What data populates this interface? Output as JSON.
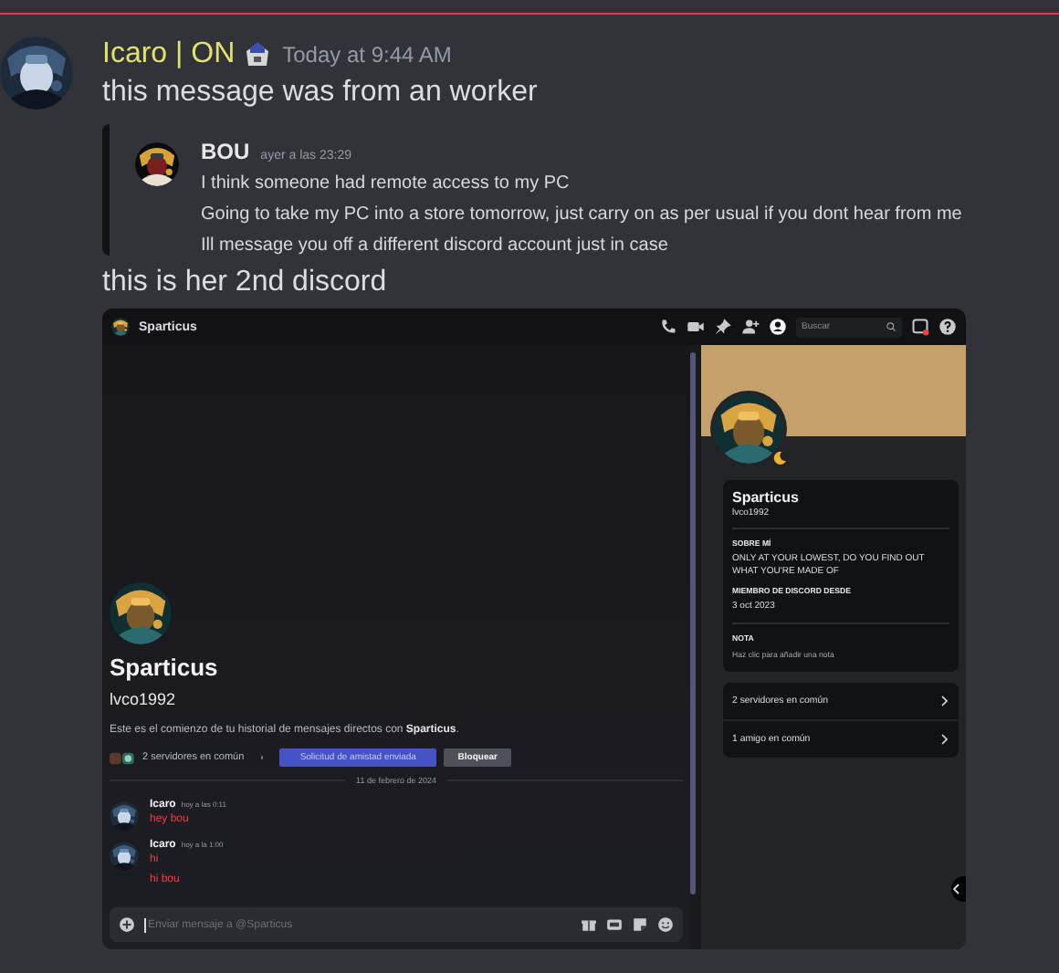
{
  "message": {
    "author": "Icaro | ON",
    "time": "Today at 9:44 AM",
    "text": "this message was from an worker"
  },
  "quote": {
    "author": "BOU",
    "time": "ayer a las 23:29",
    "lines": [
      "I think someone had remote access to my PC",
      "Going to take my PC into a store tomorrow, just carry on as per usual if you dont hear from me",
      "Ill message you off a different discord account just in case"
    ]
  },
  "message_2": {
    "text": "this is her 2nd discord"
  },
  "screenshot": {
    "header": {
      "title": "Sparticus"
    },
    "search": {
      "placeholder": "Buscar"
    },
    "intro": {
      "display_name": "Sparticus",
      "username": "lvco1992",
      "text": "Este es el comienzo de tu historial de mensajes directos con **Sparticus**.",
      "mutual_servers": "2 servidores en común",
      "friend_request": "Solicitud de amistad enviada",
      "block": "Bloquear"
    },
    "date_divider": "11 de febrero de 2024",
    "messages": [
      {
        "author": "Icaro",
        "time": "hoy a las 0:11",
        "lines": [
          "hey bou"
        ]
      },
      {
        "author": "Icaro",
        "time": "hoy a la 1:00",
        "lines": [
          "hi",
          "hi bou"
        ]
      }
    ],
    "composer": {
      "placeholder": "Enviar mensaje a @Sparticus"
    },
    "profile": {
      "display_name": "Sparticus",
      "username": "lvco1992",
      "sections": [
        {
          "heading": "SOBRE MÍ",
          "text": "ONLY AT YOUR LOWEST, DO YOU FIND OUT WHAT YOU'RE MADE OF"
        },
        {
          "heading": "MIEMBRO DE DISCORD DESDE",
          "text": "3 oct 2023"
        }
      ],
      "note": {
        "heading": "NOTA",
        "placeholder": "Haz clic para añadir una nota"
      },
      "mutuals": [
        "2 servidores en común",
        "1 amigo en común"
      ]
    }
  }
}
